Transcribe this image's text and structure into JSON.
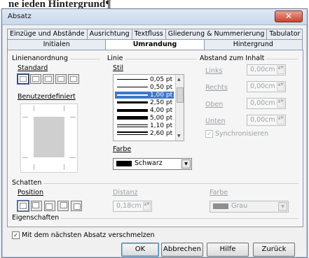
{
  "background_doc_text": "ne ieden Hintergrund¶",
  "window": {
    "title": "Absatz",
    "close_glyph": "✕"
  },
  "tabs_row1": [
    "Einzüge und Abstände",
    "Ausrichtung",
    "Textfluss",
    "Gliederung & Nummerierung",
    "Tabulator"
  ],
  "tabs_row2": [
    {
      "label": "Initialen",
      "active": false
    },
    {
      "label": "Umrandung",
      "active": true
    },
    {
      "label": "Hintergrund",
      "active": false
    }
  ],
  "linienanordnung": {
    "title": "Linienanordnung",
    "standard_label": "Standard",
    "benutzerdefiniert_label": "Benutzerdefiniert"
  },
  "linie": {
    "title": "Linie",
    "stil_label": "Stil",
    "styles": [
      "0,05 pt",
      "0,50 pt",
      "1,00 pt",
      "2,50 pt",
      "4,00 pt",
      "5,00 pt",
      "1,10 pt",
      "2,60 pt"
    ],
    "selected_index": 2,
    "farbe_label": "Farbe",
    "farbe_value": "Schwarz",
    "farbe_color": "#000000"
  },
  "abstand": {
    "title": "Abstand zum Inhalt",
    "links_label": "Links",
    "links_value": "0,00cm",
    "rechts_label": "Rechts",
    "rechts_value": "0,00cm",
    "oben_label": "Oben",
    "oben_value": "0,00cm",
    "unten_label": "Unten",
    "unten_value": "0,00cm",
    "sync_label": "Synchronisieren",
    "sync_checked": true
  },
  "schatten": {
    "title": "Schatten",
    "position_label": "Position",
    "distanz_label": "Distanz",
    "distanz_value": "0,18cm",
    "farbe_label": "Farbe",
    "farbe_value": "Grau",
    "farbe_color": "#8e8e8e"
  },
  "eigenschaften": {
    "title": "Eigenschaften",
    "merge_label": "Mit dem nächsten Absatz verschmelzen",
    "merge_checked": true
  },
  "buttons": {
    "ok": "OK",
    "abbrechen": "Abbrechen",
    "hilfe": "Hilfe",
    "zurueck": "Zurück"
  },
  "accent_color": "#3d78c9"
}
